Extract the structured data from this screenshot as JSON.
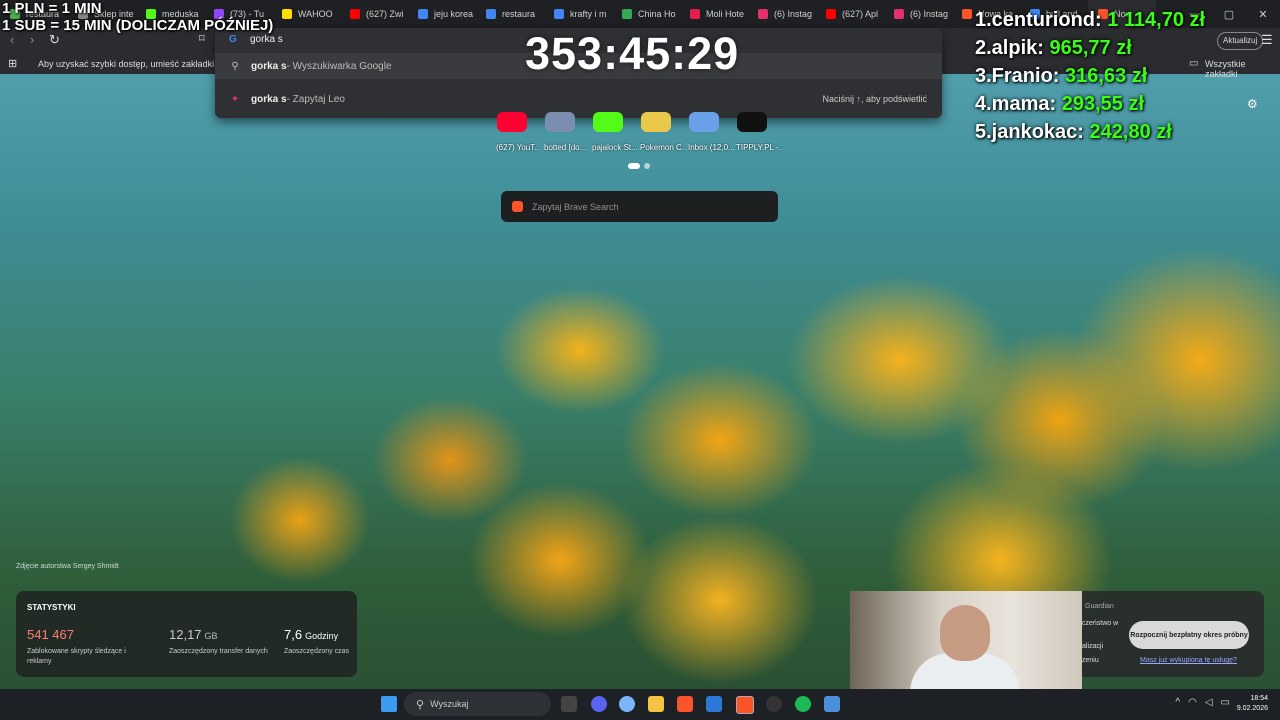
{
  "tabs": [
    {
      "label": "restaura",
      "color": "#4caf50"
    },
    {
      "label": "Sklep inte",
      "color": "#888"
    },
    {
      "label": "meduska",
      "color": "#53fc18"
    },
    {
      "label": "(73) - Tu",
      "color": "#9146ff"
    },
    {
      "label": "WAHOO",
      "color": "#ffde00"
    },
    {
      "label": "(627) Zwi",
      "color": "#ff0000"
    },
    {
      "label": "jeju korea",
      "color": "#4285f4"
    },
    {
      "label": "restaura",
      "color": "#4285f4"
    },
    {
      "label": "krafty i m",
      "color": "#4285f4"
    },
    {
      "label": "China Ho",
      "color": "#34a853"
    },
    {
      "label": "Moli Hote",
      "color": "#e61e4d"
    },
    {
      "label": "(6) Instag",
      "color": "#e1306c"
    },
    {
      "label": "(627) Apl",
      "color": "#ff0000"
    },
    {
      "label": "(6) Instag",
      "color": "#e1306c"
    },
    {
      "label": "Nowa ka",
      "color": "#fb542b"
    },
    {
      "label": "bull and",
      "color": "#4285f4"
    },
    {
      "label": "Now",
      "color": "#fb542b",
      "active": true
    }
  ],
  "overlay": {
    "rate_line1": "1 PLN = 1 MIN",
    "rate_line2": "1 SUB = 15 MIN (DOLICZAM PÓŹNIEJ)",
    "timer": "353:45:29",
    "leaderboard": [
      {
        "name": "1.centuriond:",
        "amount": "1 114,70 zł"
      },
      {
        "name": "2.alpik:",
        "amount": "965,77 zł"
      },
      {
        "name": "3.Franio:",
        "amount": "316,63 zł"
      },
      {
        "name": "4.mama:",
        "amount": "293,55 zł"
      },
      {
        "name": "5.jankokac:",
        "amount": "242,80 zł"
      }
    ]
  },
  "omnibox": {
    "value": "gorka s",
    "suggestions": [
      {
        "bold": "gorka s",
        "rest": " - Wyszukiwarka Google"
      },
      {
        "bold": "gorka s",
        "rest": " - Zapytaj Leo",
        "hint": "Naciśnij ↑, aby podświetlić"
      }
    ]
  },
  "bookmarks": {
    "hint": "Aby uzyskać szybki dostęp, umieść zakładki tutaj n",
    "all": "Wszystkie zakładki"
  },
  "toolbar": {
    "update_label": "Aktualizuj"
  },
  "newtab": {
    "tiles": [
      "(627) YouT...",
      "botted [do...",
      "pajalock St...",
      "Pokemon C...",
      "Inbox (12,0...",
      "TIPPLY.PL -..."
    ],
    "search_placeholder": "Zapytaj Brave Search",
    "photo_credit": "Zdjęcie autorstwa Sergey Shmidt",
    "stats_title": "STATYSTYKI",
    "stats": [
      {
        "value": "541 467",
        "unit": "",
        "desc": "Zablokowane skrypty śledzące i reklamy",
        "color": "#ff7f6e"
      },
      {
        "value": "12,17",
        "unit": "GB",
        "desc": "Zaoszczędzony transfer danych",
        "color": "#c9c9c9"
      },
      {
        "value": "7,6",
        "unit": "Godziny",
        "desc": "Zaoszczędzony czas",
        "color": "#ffffff"
      }
    ]
  },
  "guardian": {
    "title": "Guardian",
    "lines": [
      "czeństwo w",
      "alizacji",
      "zeniu"
    ],
    "button": "Rozpocznij bezpłatny okres próbny",
    "link": "Masz już wykupioną tę usługę?"
  },
  "taskbar": {
    "search": "Wyszukaj",
    "time": "18:54",
    "date": "9.02.2026"
  }
}
